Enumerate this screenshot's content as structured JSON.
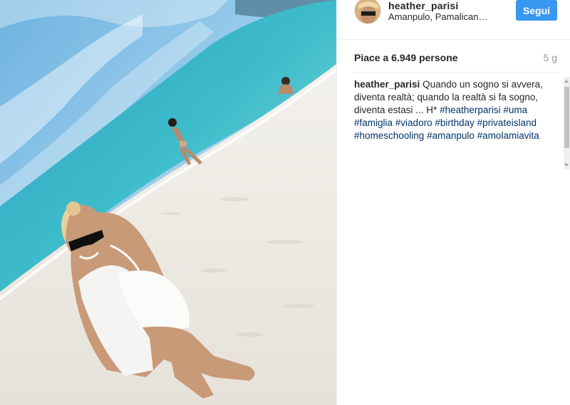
{
  "post": {
    "username": "heather_parisi",
    "location": "Amanpulo, Pamalican I...",
    "follow_label": "Segui",
    "likes": "Piace a 6.949 persone",
    "age": "5 g",
    "caption_user": "heather_parisi",
    "caption_text": "Quando un sogno si avvera, diventa realtà; quando la realtà si fa sogno, diventa estasi ... H*",
    "hashtags": [
      "#heatherparisi",
      "#uma",
      "#famiglia",
      "#viadoro",
      "#birthday",
      "#privateisland",
      "#homeschooling",
      "#amanpulo",
      "#amolamiavita"
    ]
  },
  "colors": {
    "follow_button": "#3897f0",
    "hashtag": "#003569",
    "text": "#262626",
    "muted": "#999999"
  },
  "icons": {
    "avatar": "profile-photo"
  }
}
